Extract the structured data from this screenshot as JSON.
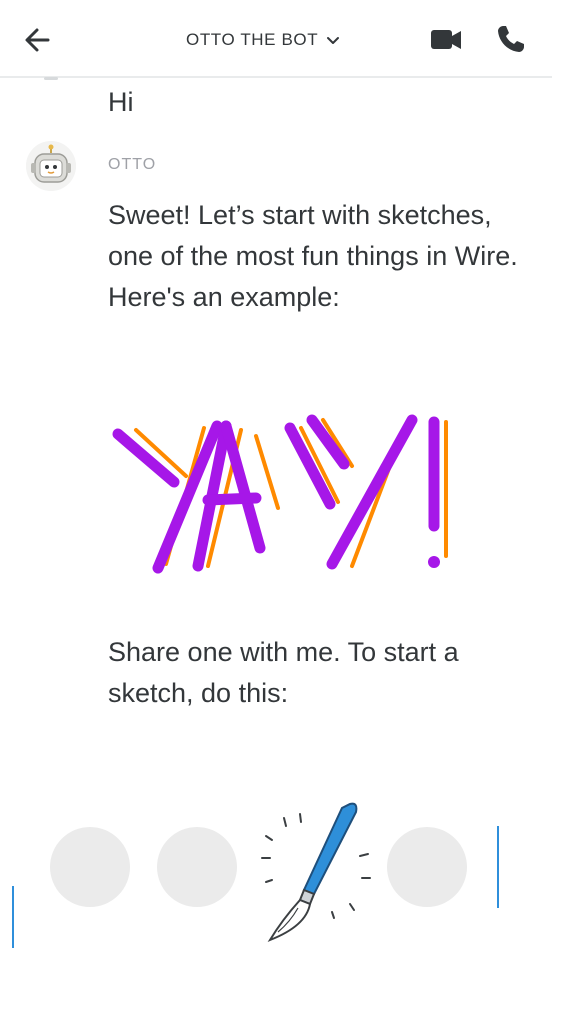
{
  "header": {
    "title": "OTTO THE BOT",
    "back_icon": "arrow-left-icon",
    "dropdown_icon": "chevron-down-icon",
    "video_icon": "video-camera-icon",
    "call_icon": "phone-icon"
  },
  "messages": {
    "self_text": "Hi",
    "bot": {
      "sender": "OTTO",
      "avatar_icon": "robot-avatar-icon",
      "text": "Sweet! Let’s start with sketches, one of the most fun things in Wire. Here's an example:",
      "sketch_text": "YAY!",
      "follow_up": "Share one with me. To start a sketch, do this:"
    }
  },
  "hint": {
    "icon": "paintbrush-icon"
  },
  "colors": {
    "sketch_primary": "#a617e8",
    "sketch_shadow": "#ff8a00",
    "accent_blue": "#2f8fdb",
    "placeholder": "#ebebeb"
  }
}
